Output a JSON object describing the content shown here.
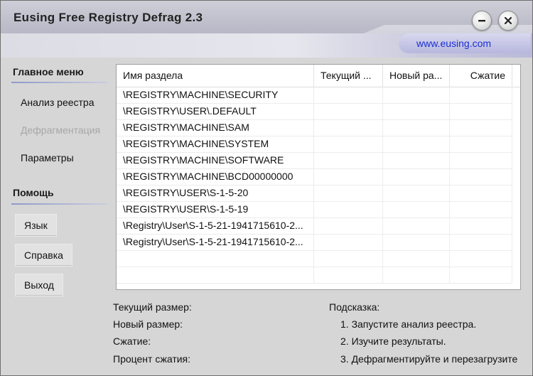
{
  "window": {
    "title": "Eusing Free Registry Defrag 2.3",
    "website": "www.eusing.com",
    "controls": {
      "minimize": "minimize",
      "close": "close"
    }
  },
  "sidebar": {
    "main_menu_header": "Главное меню",
    "main_items": [
      {
        "label": "Анализ реестра",
        "enabled": true
      },
      {
        "label": "Дефрагментация",
        "enabled": false
      },
      {
        "label": "Параметры",
        "enabled": true
      }
    ],
    "help_header": "Помощь",
    "help_buttons": [
      {
        "label": "Язык"
      },
      {
        "label": "Справка"
      },
      {
        "label": "Выход"
      }
    ]
  },
  "table": {
    "columns": [
      "Имя раздела",
      "Текущий ...",
      "Новый ра...",
      "Сжатие"
    ],
    "rows": [
      [
        "\\REGISTRY\\MACHINE\\SECURITY",
        "",
        "",
        ""
      ],
      [
        "\\REGISTRY\\USER\\.DEFAULT",
        "",
        "",
        ""
      ],
      [
        "\\REGISTRY\\MACHINE\\SAM",
        "",
        "",
        ""
      ],
      [
        "\\REGISTRY\\MACHINE\\SYSTEM",
        "",
        "",
        ""
      ],
      [
        "\\REGISTRY\\MACHINE\\SOFTWARE",
        "",
        "",
        ""
      ],
      [
        "\\REGISTRY\\MACHINE\\BCD00000000",
        "",
        "",
        ""
      ],
      [
        "\\REGISTRY\\USER\\S-1-5-20",
        "",
        "",
        ""
      ],
      [
        "\\REGISTRY\\USER\\S-1-5-19",
        "",
        "",
        ""
      ],
      [
        "\\Registry\\User\\S-1-5-21-1941715610-2...",
        "",
        "",
        ""
      ],
      [
        "\\Registry\\User\\S-1-5-21-1941715610-2...",
        "",
        "",
        ""
      ],
      [
        "",
        "",
        "",
        ""
      ],
      [
        "",
        "",
        "",
        ""
      ]
    ]
  },
  "info": {
    "current_size_label": "Текущий размер:",
    "new_size_label": "Новый размер:",
    "compression_label": "Сжатие:",
    "percent_label": "Процент сжатия:"
  },
  "hint": {
    "title": "Подсказка:",
    "steps": [
      "1. Запустите анализ реестра.",
      "2. Изучите результаты.",
      "3. Дефрагментируйте и перезагрузите"
    ]
  },
  "colors": {
    "link": "#1a2ed6",
    "disabled_text": "#a7a7a7"
  }
}
